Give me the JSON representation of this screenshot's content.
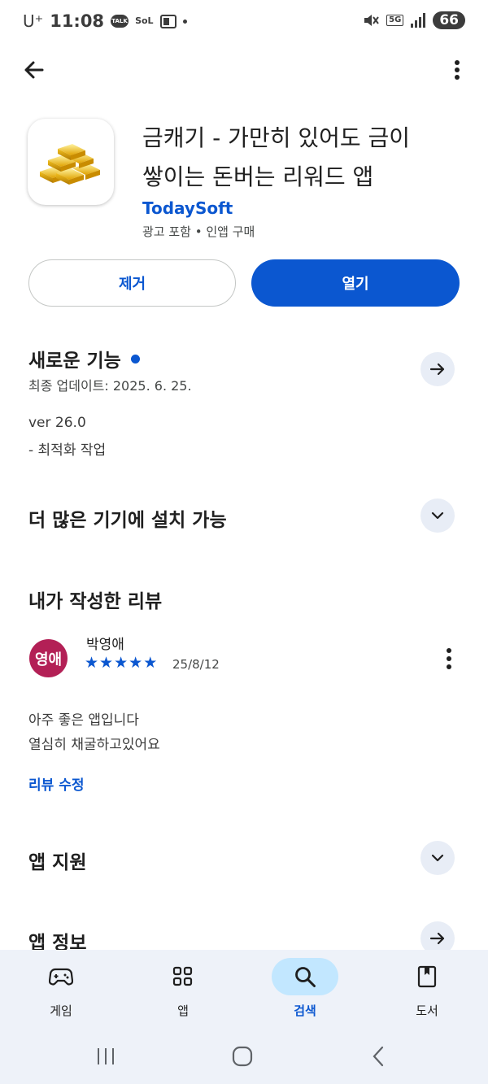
{
  "status_bar": {
    "carrier": "U⁺",
    "time": "11:08",
    "talk_icon_text": "TALK",
    "sol_icon_text": "SoL",
    "network": "5G",
    "battery": "66"
  },
  "app": {
    "title_line1": "금캐기 - 가만히 있어도 금이",
    "title_line2": "쌓이는 돈버는 리워드 앱",
    "developer": "TodaySoft",
    "meta": "광고 포함 • 인앱 구매",
    "remove_label": "제거",
    "open_label": "열기"
  },
  "whats_new": {
    "title": "새로운 기능",
    "last_updated": "최종 업데이트: 2025. 6. 25.",
    "version": "ver 26.0",
    "notes": "- 최적화 작업"
  },
  "more_devices": {
    "title": "더 많은 기기에 설치 가능"
  },
  "my_review": {
    "title": "내가 작성한 리뷰",
    "avatar_text": "영애",
    "reviewer_name": "박영애",
    "rating": 5,
    "date": "25/8/12",
    "text_line1": "아주 좋은 앱입니다",
    "text_line2": "열심히 채굴하고있어요",
    "edit_label": "리뷰 수정"
  },
  "app_support": {
    "title": "앱 지원"
  },
  "app_info": {
    "title": "앱 정보"
  },
  "bottom_nav": {
    "items": [
      {
        "label": "게임",
        "icon": "gamepad-icon"
      },
      {
        "label": "앱",
        "icon": "apps-grid-icon"
      },
      {
        "label": "검색",
        "icon": "search-icon",
        "active": true
      },
      {
        "label": "도서",
        "icon": "book-icon"
      }
    ]
  },
  "colors": {
    "accent": "#0b57d0",
    "avatar": "#b32056",
    "nav_bg": "#eef2f9",
    "active_pill": "#c2e7ff"
  }
}
